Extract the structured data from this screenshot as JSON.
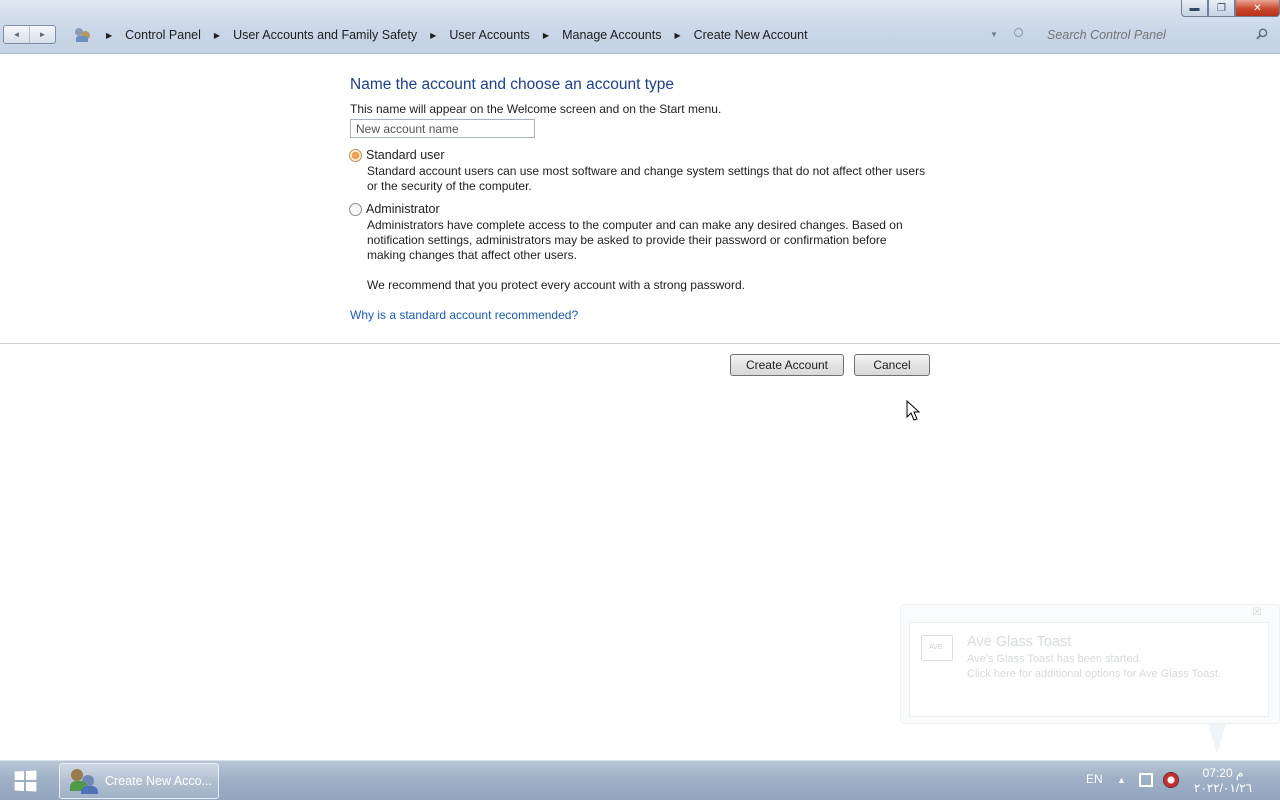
{
  "window": {
    "controls": {
      "minimize": "▬",
      "maximize": "❐",
      "close": "✕"
    }
  },
  "nav": {
    "back": "◄",
    "forward": "►"
  },
  "breadcrumb": {
    "separator": "▶",
    "items": [
      "Control Panel",
      "User Accounts and Family Safety",
      "User Accounts",
      "Manage Accounts",
      "Create New Account"
    ]
  },
  "search": {
    "placeholder": "Search Control Panel"
  },
  "main": {
    "heading": "Name the account and choose an account type",
    "instruction": "This name will appear on the Welcome screen and on the Start menu.",
    "name_placeholder": "New account name",
    "options": [
      {
        "label": "Standard user",
        "selected": true,
        "description": "Standard account users can use most software and change system settings that do not affect other users or the security of the computer."
      },
      {
        "label": "Administrator",
        "selected": false,
        "description": "Administrators have complete access to the computer and can make any desired changes. Based on notification settings, administrators may be asked to provide their password or confirmation before making changes that affect other users."
      }
    ],
    "recommendation": "We recommend that you protect every account with a strong password.",
    "help_link": "Why is a standard account recommended?",
    "create_button": "Create Account",
    "cancel_button": "Cancel"
  },
  "toast": {
    "close": "☒",
    "icon_text": "AVE",
    "title": "Ave Glass Toast",
    "line1": "Ave's Glass Toast has been started.",
    "line2": "Click here for additional options for Ave Glass Toast."
  },
  "taskbar": {
    "task_label": "Create New Acco...",
    "language": "EN",
    "tray_arrow": "▲",
    "time": "07:20 م",
    "date": "٢٠٢٢/٠١/٢٦"
  },
  "colors": {
    "heading": "#1e3f8a",
    "link": "#1d5aab",
    "close_button": "#c9472f"
  }
}
